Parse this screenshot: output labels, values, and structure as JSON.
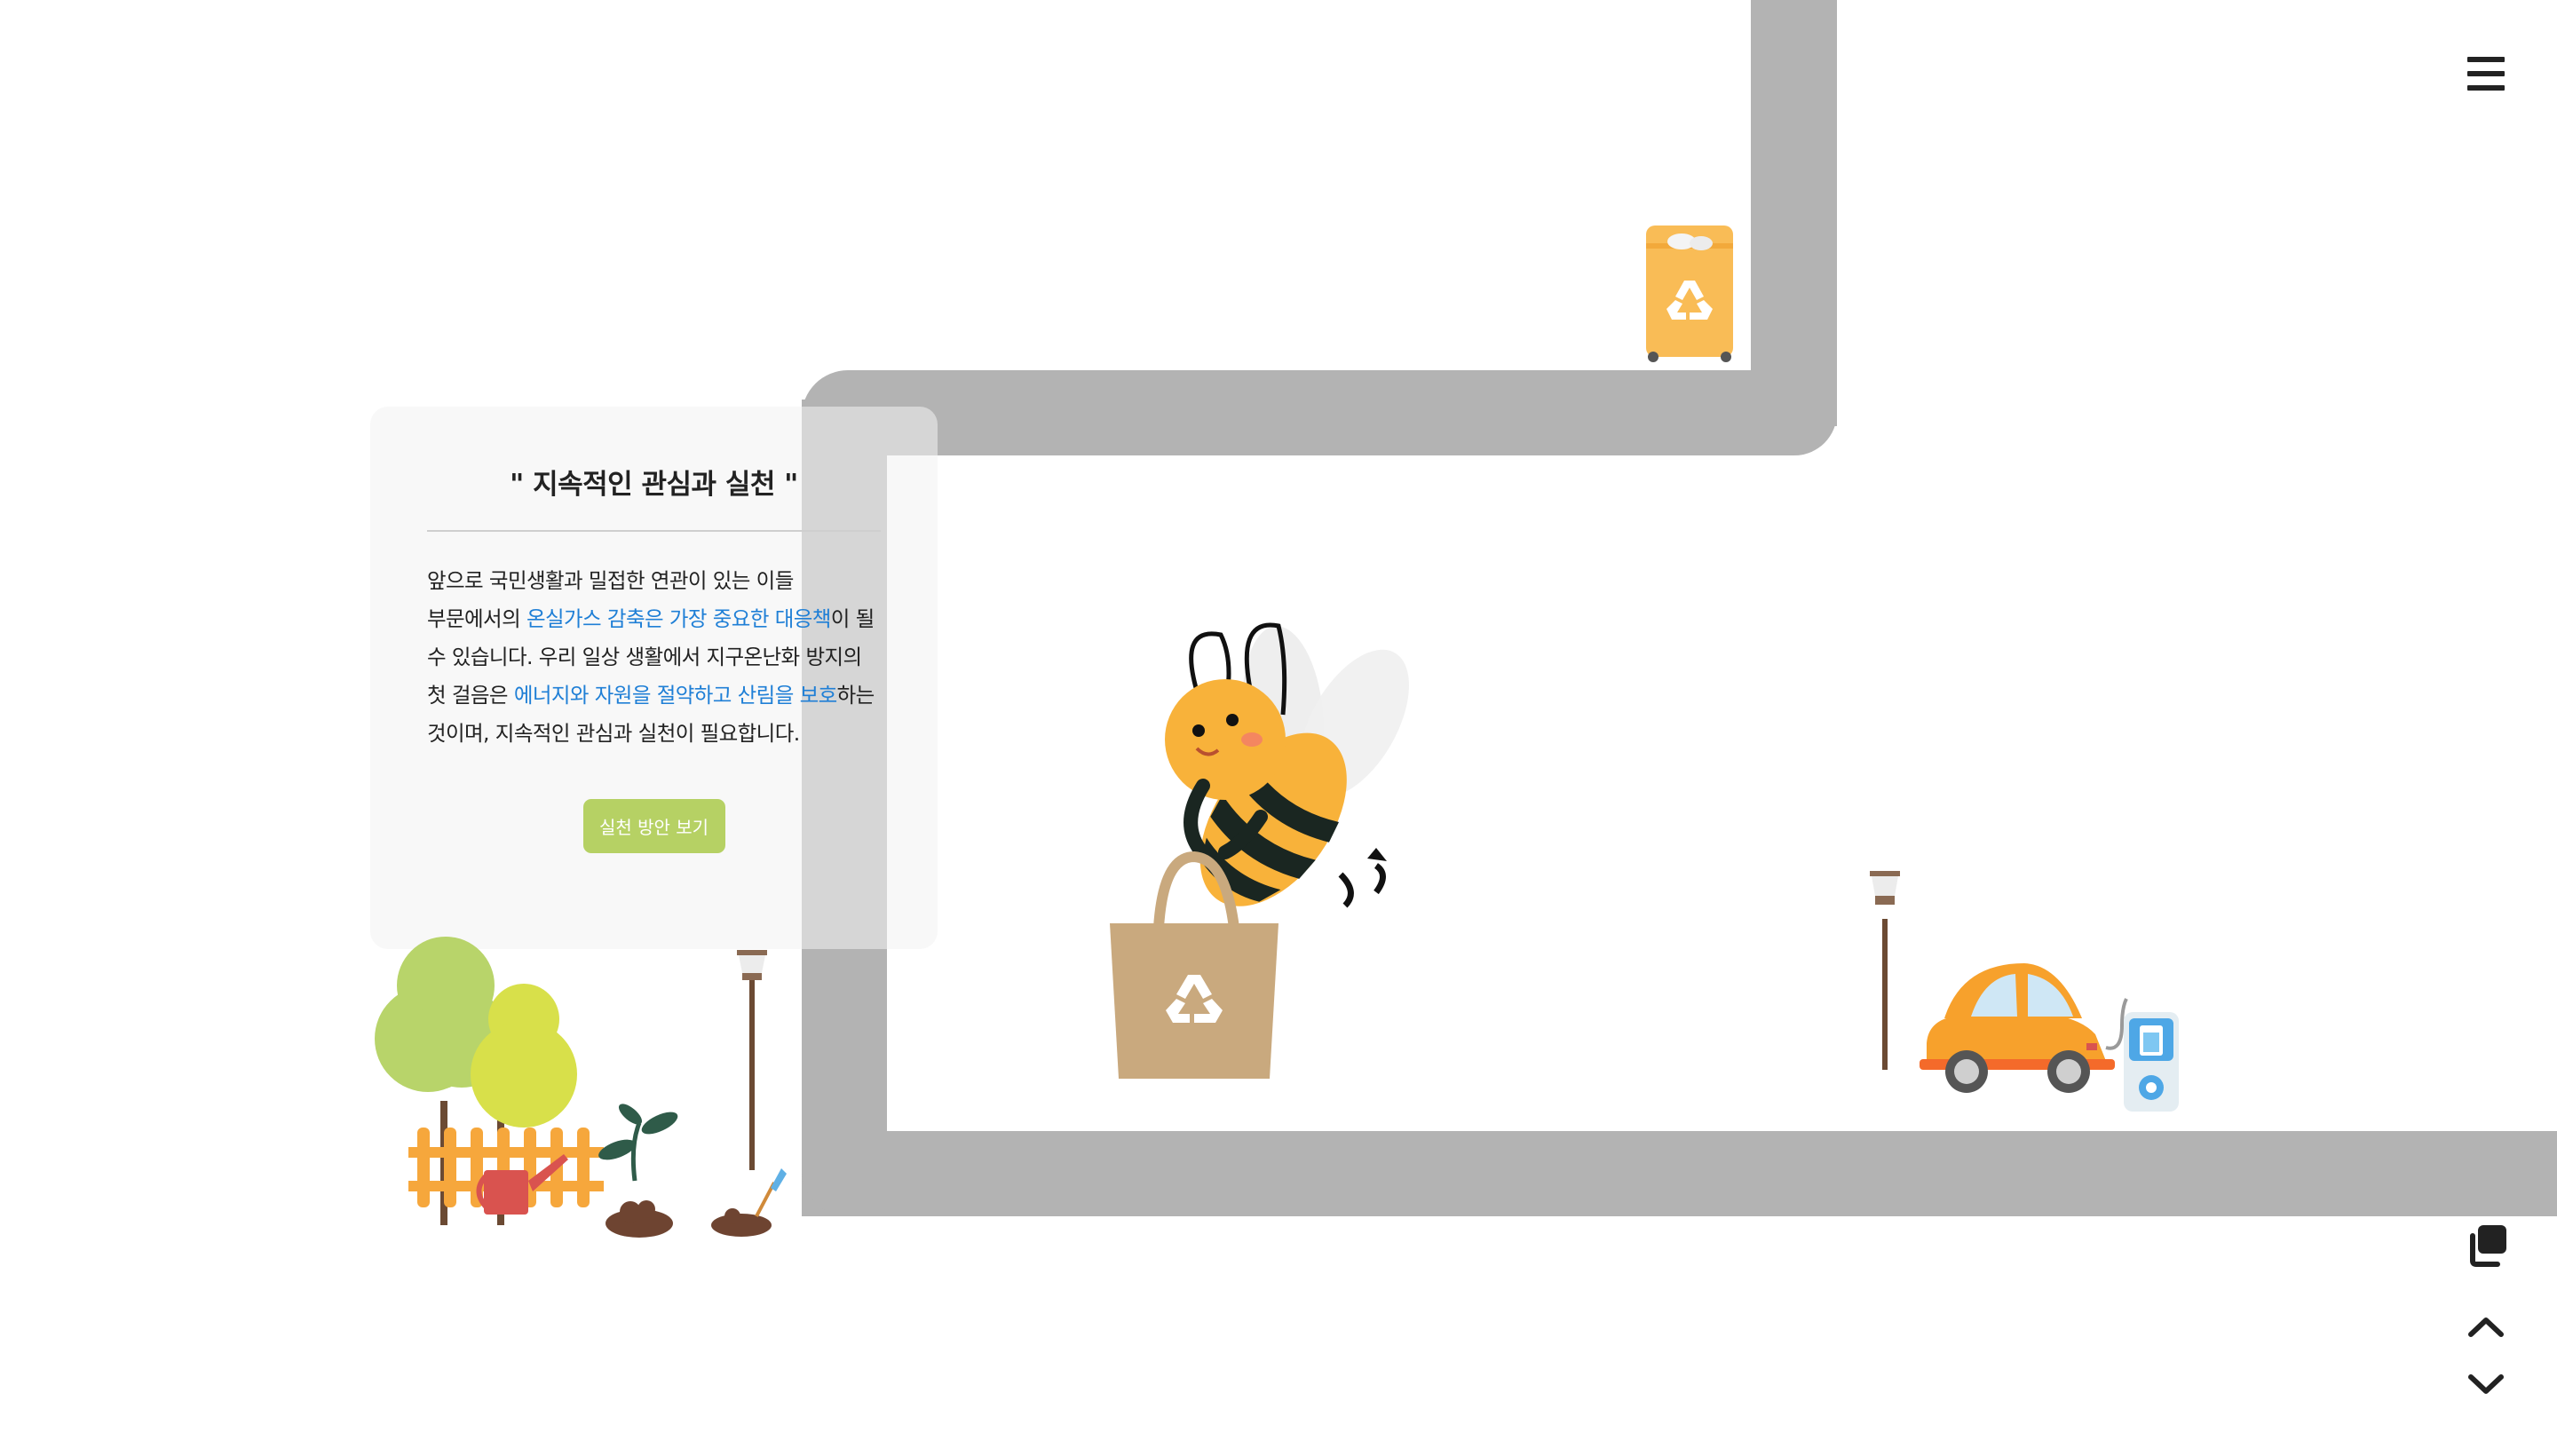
{
  "card": {
    "title": "\" 지속적인 관심과 실천 \"",
    "body": [
      {
        "text": "앞으로 국민생활과 밀접한 연관이 있는 이들 부문에서의 ",
        "highlight": false
      },
      {
        "text": "온실가스 감축은 가장 중요한 대응책",
        "highlight": true
      },
      {
        "text": "이 될 수 있습니다. 우리 일상 생활에서 지구온난화 방지의 첫 걸음은 ",
        "highlight": false
      },
      {
        "text": "에너지와 자원을 절약하고 산림을 보호",
        "highlight": true
      },
      {
        "text": "하는 것이며, 지속적인 관심과 실천이 필요합니다.",
        "highlight": false
      }
    ],
    "button_label": "실천 방안 보기"
  },
  "controls": {
    "menu_icon": "hamburger-menu-icon",
    "copy_icon": "copy-icon",
    "up_icon": "chevron-up-icon",
    "down_icon": "chevron-down-icon"
  },
  "colors": {
    "road": "#b3b3b3",
    "highlight": "#1f7fd6",
    "button": "#b6d164",
    "bee_yellow": "#f8b23a",
    "car_orange": "#f7a12c",
    "recycle_bin": "#f9bc56",
    "bag": "#c9a97e"
  }
}
